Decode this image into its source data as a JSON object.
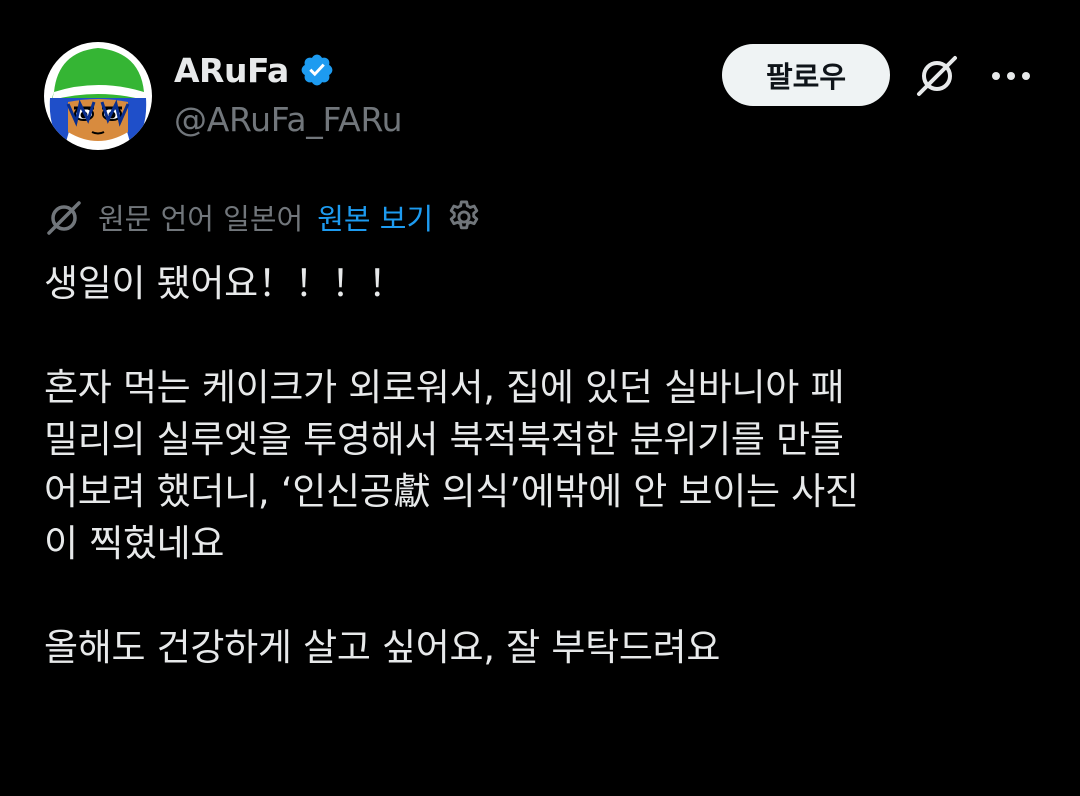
{
  "author": {
    "display_name": "ARuFa",
    "handle": "@ARuFa_FARu",
    "verified": true,
    "avatar_icon": "avatar-cartoon-face-icon"
  },
  "actions": {
    "follow_label": "팔로우",
    "grok_icon": "grok-icon",
    "more_icon": "more-dots-icon"
  },
  "translation": {
    "note": "원문 언어 일본어",
    "show_original": "원본 보기",
    "icon": "translate-icon",
    "settings_icon": "gear-icon"
  },
  "tweet": {
    "lines": [
      "생일이 됐어요！！！！",
      "",
      "혼자 먹는 케이크가 외로워서, 집에 있던 실바니아 패",
      "밀리의 실루엣을 투영해서 북적북적한 분위기를 만들",
      "어보려 했더니, ‘인신공獻 의식’에밖에 안 보이는 사진",
      "이 찍혔네요",
      "",
      "올해도 건강하게 살고 싶어요, 잘 부탁드려요"
    ]
  },
  "colors": {
    "background": "#000000",
    "text_primary": "#e7e9ea",
    "text_secondary": "#71767b",
    "link_blue": "#1d9bf0",
    "verified_blue": "#1d9bf0",
    "follow_bg": "#eff3f4"
  }
}
